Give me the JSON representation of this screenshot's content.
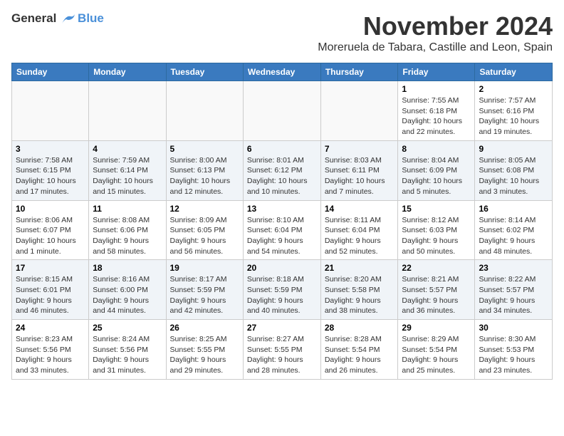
{
  "header": {
    "logo_line1": "General",
    "logo_line2": "Blue",
    "month_year": "November 2024",
    "location": "Moreruela de Tabara, Castille and Leon, Spain"
  },
  "weekdays": [
    "Sunday",
    "Monday",
    "Tuesday",
    "Wednesday",
    "Thursday",
    "Friday",
    "Saturday"
  ],
  "weeks": [
    [
      {
        "day": "",
        "info": ""
      },
      {
        "day": "",
        "info": ""
      },
      {
        "day": "",
        "info": ""
      },
      {
        "day": "",
        "info": ""
      },
      {
        "day": "",
        "info": ""
      },
      {
        "day": "1",
        "info": "Sunrise: 7:55 AM\nSunset: 6:18 PM\nDaylight: 10 hours\nand 22 minutes."
      },
      {
        "day": "2",
        "info": "Sunrise: 7:57 AM\nSunset: 6:16 PM\nDaylight: 10 hours\nand 19 minutes."
      }
    ],
    [
      {
        "day": "3",
        "info": "Sunrise: 7:58 AM\nSunset: 6:15 PM\nDaylight: 10 hours\nand 17 minutes."
      },
      {
        "day": "4",
        "info": "Sunrise: 7:59 AM\nSunset: 6:14 PM\nDaylight: 10 hours\nand 15 minutes."
      },
      {
        "day": "5",
        "info": "Sunrise: 8:00 AM\nSunset: 6:13 PM\nDaylight: 10 hours\nand 12 minutes."
      },
      {
        "day": "6",
        "info": "Sunrise: 8:01 AM\nSunset: 6:12 PM\nDaylight: 10 hours\nand 10 minutes."
      },
      {
        "day": "7",
        "info": "Sunrise: 8:03 AM\nSunset: 6:11 PM\nDaylight: 10 hours\nand 7 minutes."
      },
      {
        "day": "8",
        "info": "Sunrise: 8:04 AM\nSunset: 6:09 PM\nDaylight: 10 hours\nand 5 minutes."
      },
      {
        "day": "9",
        "info": "Sunrise: 8:05 AM\nSunset: 6:08 PM\nDaylight: 10 hours\nand 3 minutes."
      }
    ],
    [
      {
        "day": "10",
        "info": "Sunrise: 8:06 AM\nSunset: 6:07 PM\nDaylight: 10 hours\nand 1 minute."
      },
      {
        "day": "11",
        "info": "Sunrise: 8:08 AM\nSunset: 6:06 PM\nDaylight: 9 hours\nand 58 minutes."
      },
      {
        "day": "12",
        "info": "Sunrise: 8:09 AM\nSunset: 6:05 PM\nDaylight: 9 hours\nand 56 minutes."
      },
      {
        "day": "13",
        "info": "Sunrise: 8:10 AM\nSunset: 6:04 PM\nDaylight: 9 hours\nand 54 minutes."
      },
      {
        "day": "14",
        "info": "Sunrise: 8:11 AM\nSunset: 6:04 PM\nDaylight: 9 hours\nand 52 minutes."
      },
      {
        "day": "15",
        "info": "Sunrise: 8:12 AM\nSunset: 6:03 PM\nDaylight: 9 hours\nand 50 minutes."
      },
      {
        "day": "16",
        "info": "Sunrise: 8:14 AM\nSunset: 6:02 PM\nDaylight: 9 hours\nand 48 minutes."
      }
    ],
    [
      {
        "day": "17",
        "info": "Sunrise: 8:15 AM\nSunset: 6:01 PM\nDaylight: 9 hours\nand 46 minutes."
      },
      {
        "day": "18",
        "info": "Sunrise: 8:16 AM\nSunset: 6:00 PM\nDaylight: 9 hours\nand 44 minutes."
      },
      {
        "day": "19",
        "info": "Sunrise: 8:17 AM\nSunset: 5:59 PM\nDaylight: 9 hours\nand 42 minutes."
      },
      {
        "day": "20",
        "info": "Sunrise: 8:18 AM\nSunset: 5:59 PM\nDaylight: 9 hours\nand 40 minutes."
      },
      {
        "day": "21",
        "info": "Sunrise: 8:20 AM\nSunset: 5:58 PM\nDaylight: 9 hours\nand 38 minutes."
      },
      {
        "day": "22",
        "info": "Sunrise: 8:21 AM\nSunset: 5:57 PM\nDaylight: 9 hours\nand 36 minutes."
      },
      {
        "day": "23",
        "info": "Sunrise: 8:22 AM\nSunset: 5:57 PM\nDaylight: 9 hours\nand 34 minutes."
      }
    ],
    [
      {
        "day": "24",
        "info": "Sunrise: 8:23 AM\nSunset: 5:56 PM\nDaylight: 9 hours\nand 33 minutes."
      },
      {
        "day": "25",
        "info": "Sunrise: 8:24 AM\nSunset: 5:56 PM\nDaylight: 9 hours\nand 31 minutes."
      },
      {
        "day": "26",
        "info": "Sunrise: 8:25 AM\nSunset: 5:55 PM\nDaylight: 9 hours\nand 29 minutes."
      },
      {
        "day": "27",
        "info": "Sunrise: 8:27 AM\nSunset: 5:55 PM\nDaylight: 9 hours\nand 28 minutes."
      },
      {
        "day": "28",
        "info": "Sunrise: 8:28 AM\nSunset: 5:54 PM\nDaylight: 9 hours\nand 26 minutes."
      },
      {
        "day": "29",
        "info": "Sunrise: 8:29 AM\nSunset: 5:54 PM\nDaylight: 9 hours\nand 25 minutes."
      },
      {
        "day": "30",
        "info": "Sunrise: 8:30 AM\nSunset: 5:53 PM\nDaylight: 9 hours\nand 23 minutes."
      }
    ]
  ]
}
